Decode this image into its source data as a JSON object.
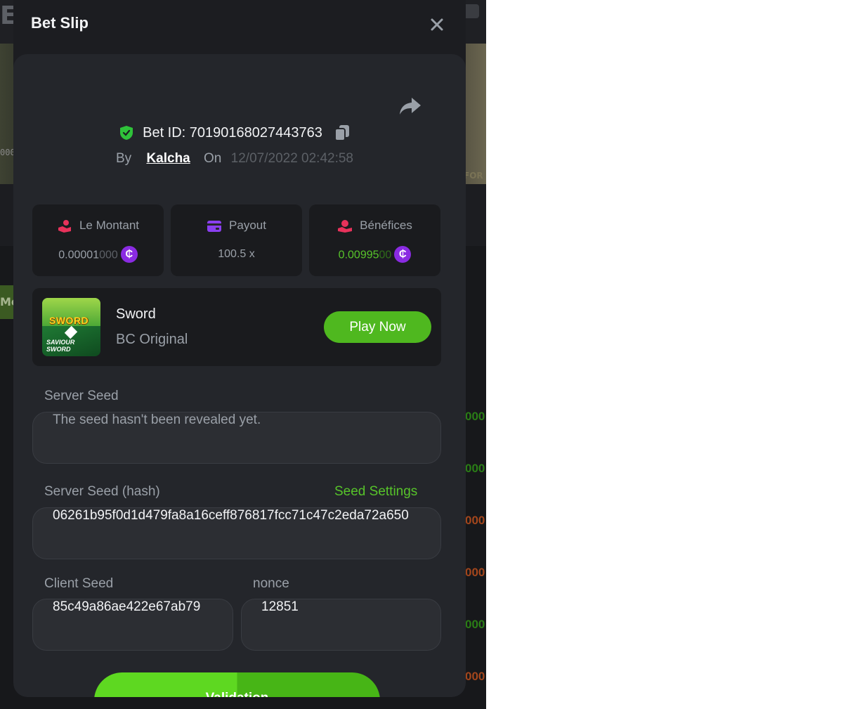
{
  "backdrop": {
    "logo_text": "E",
    "left_text": "000",
    "right_text": "FOR",
    "tab_text": "Mo",
    "right_numbers": [
      {
        "text": "000",
        "color": "#2a7d16"
      },
      {
        "text": "000",
        "color": "#2a7d16"
      },
      {
        "text": "000",
        "color": "#a3461c"
      },
      {
        "text": "000",
        "color": "#a3461c"
      },
      {
        "text": "000",
        "color": "#2a7d16"
      },
      {
        "text": "000",
        "color": "#a3461c"
      }
    ]
  },
  "modal": {
    "title": "Bet Slip",
    "bet_id": "Bet ID: 70190168027443763",
    "by_label": "By",
    "username": "Kalcha",
    "on_label": "On",
    "date": "12/07/2022 02:42:58"
  },
  "stats": [
    {
      "label": "Le Montant",
      "value_main": "0.00001",
      "value_dim": "000",
      "icon": "money-hand-icon",
      "coin": "₵"
    },
    {
      "label": "Payout",
      "value_main": "100.5 x",
      "value_dim": "",
      "icon": "card-icon"
    },
    {
      "label": "Bénéfices",
      "value_main": "0.00995",
      "value_dim": "00",
      "icon": "profit-hand-icon",
      "coin": "₵"
    }
  ],
  "game": {
    "name": "Sword",
    "provider": "BC Original",
    "play_label": "Play Now",
    "thumb_title": "SWORD",
    "thumb_sub": "SAVIOUR\nSWORD"
  },
  "fields": {
    "server_seed_label": "Server Seed",
    "server_seed_value": "The seed hasn't been revealed yet.",
    "server_hash_label": "Server Seed (hash)",
    "seed_settings_label": "Seed Settings",
    "server_hash_value": "06261b95f0d1d479fa8a16ceff876817fcc71c47c2eda72a650",
    "client_seed_label": "Client Seed",
    "client_seed_value": "85c49a86ae422e67ab79",
    "nonce_label": "nonce",
    "nonce_value": "12851"
  },
  "validate_label": "Validation",
  "colors": {
    "accent_green": "#57c42a",
    "coin_purple": "#8a2be2",
    "verified_green": "#2fc23a"
  }
}
